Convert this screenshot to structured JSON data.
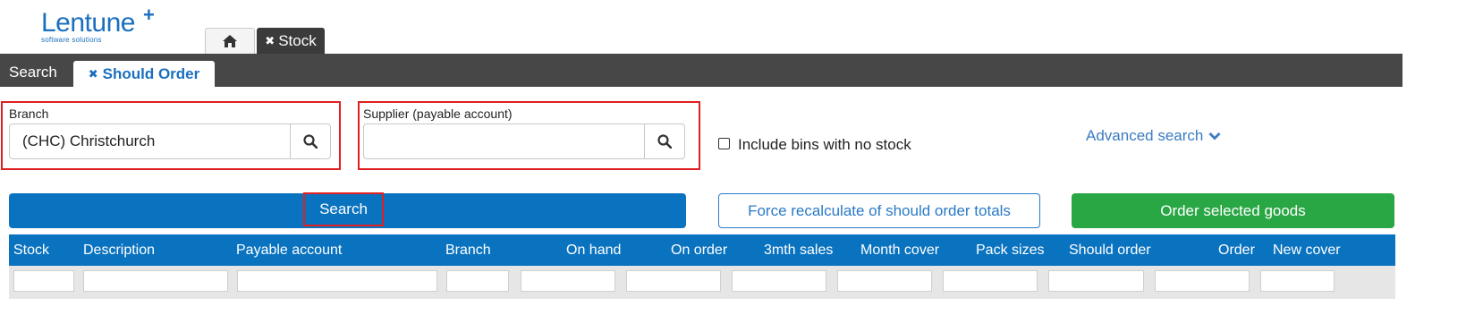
{
  "logo": {
    "name": "Lentune",
    "plus": "+",
    "tagline": "software solutions"
  },
  "top_tabs": {
    "home_icon": "home-icon",
    "stock_label": "Stock",
    "close_glyph": "✖"
  },
  "sub_tabs": {
    "search_label": "Search",
    "should_order_label": "Should Order",
    "close_glyph": "✖"
  },
  "branch": {
    "label": "Branch",
    "value": "(CHC) Christchurch",
    "icon": "search-icon"
  },
  "supplier": {
    "label": "Supplier (payable account)",
    "value": "",
    "icon": "search-icon"
  },
  "include_bins": {
    "label": "Include bins with no stock",
    "checked": false
  },
  "advanced_search": {
    "label": "Advanced search",
    "icon": "chevron-down-icon"
  },
  "actions": {
    "search_label": "Search",
    "force_label": "Force recalculate of should order totals",
    "order_label": "Order selected goods"
  },
  "table": {
    "columns": [
      "Stock",
      "Description",
      "Payable account",
      "Branch",
      "On hand",
      "On order",
      "3mth sales",
      "Month cover",
      "Pack sizes",
      "Should order",
      "Order",
      "New cover"
    ]
  },
  "colors": {
    "brand": "#1b6fbf",
    "primary": "#0a73c0",
    "success": "#2aa745",
    "highlight": "#e02020",
    "dark_bar": "#474747"
  }
}
